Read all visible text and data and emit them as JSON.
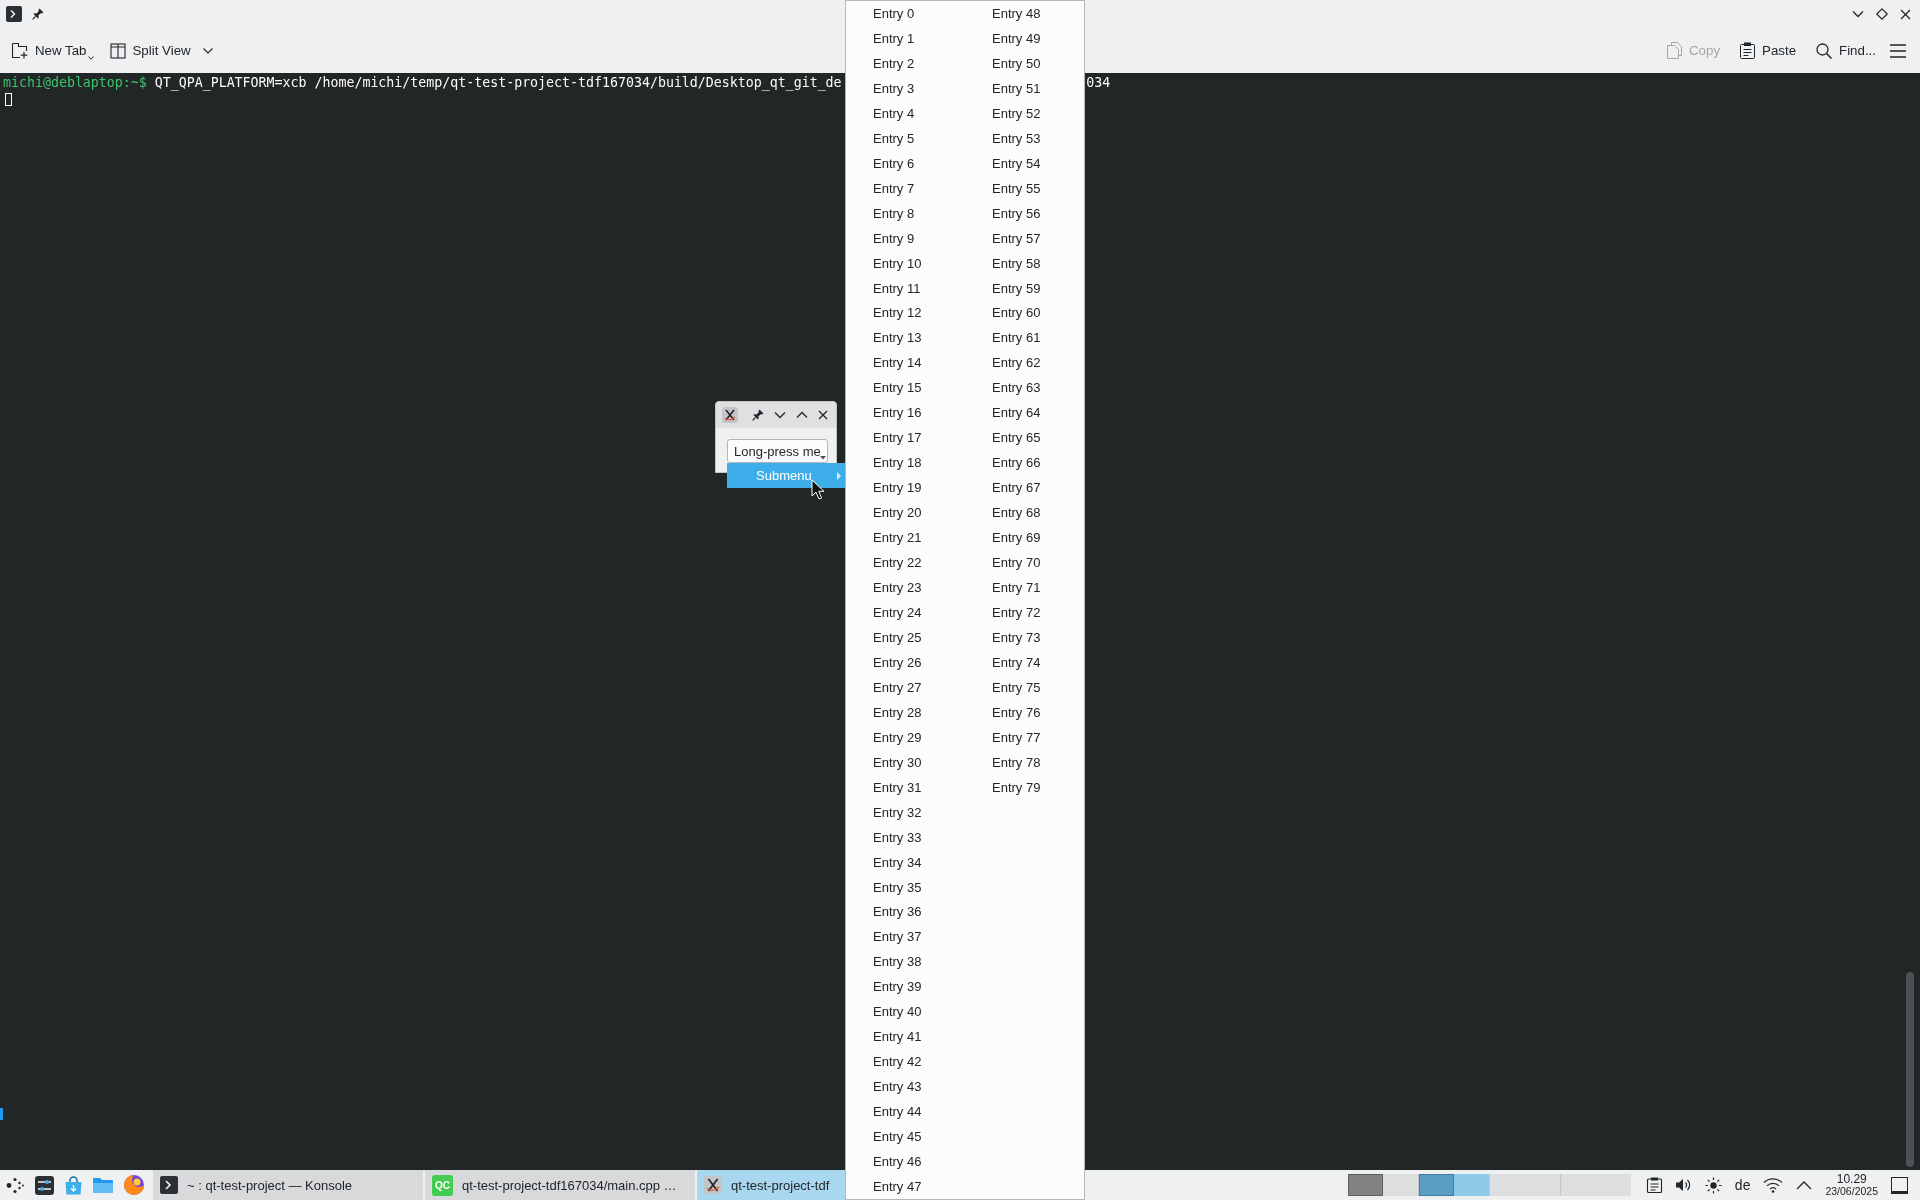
{
  "terminal_window": {
    "toolbar": {
      "left_actions": [
        {
          "label": "New Tab",
          "kind": "new-tab"
        },
        {
          "label": "Split View",
          "kind": "split-view"
        }
      ],
      "right_actions": [
        {
          "label": "Copy",
          "kind": "copy",
          "disabled": true
        },
        {
          "label": "Paste",
          "kind": "paste",
          "disabled": false
        },
        {
          "label": "Find...",
          "kind": "find",
          "disabled": false
        }
      ]
    },
    "terminal": {
      "prompt": "michi@deblaptop:~$",
      "command": "QT_QPA_PLATFORM=xcb /home/michi/temp/qt-test-project-tdf167034/build/Desktop_qt_git_de",
      "command_tail": "034"
    }
  },
  "test_window": {
    "button": "Long-press me"
  },
  "context_menu": {
    "items": [
      {
        "label": "Submenu",
        "selected": true,
        "has_submenu": true
      }
    ]
  },
  "submenu": {
    "entries": [
      {
        "label": "Entry 0",
        "selected": false
      },
      {
        "label": "Entry 1",
        "selected": false
      },
      {
        "label": "Entry 2",
        "selected": false
      },
      {
        "label": "Entry 3",
        "selected": false
      },
      {
        "label": "Entry 4",
        "selected": false
      },
      {
        "label": "Entry 5",
        "selected": false
      },
      {
        "label": "Entry 6",
        "selected": false
      },
      {
        "label": "Entry 7",
        "selected": false
      },
      {
        "label": "Entry 8",
        "selected": false
      },
      {
        "label": "Entry 9",
        "selected": false
      },
      {
        "label": "Entry 10",
        "selected": false
      },
      {
        "label": "Entry 11",
        "selected": false
      },
      {
        "label": "Entry 12",
        "selected": false
      },
      {
        "label": "Entry 13",
        "selected": false
      },
      {
        "label": "Entry 14",
        "selected": false
      },
      {
        "label": "Entry 15",
        "selected": false
      },
      {
        "label": "Entry 16",
        "selected": false
      },
      {
        "label": "Entry 17",
        "selected": false
      },
      {
        "label": "Entry 18",
        "selected": false
      },
      {
        "label": "Entry 19",
        "selected": false
      },
      {
        "label": "Entry 20",
        "selected": false
      },
      {
        "label": "Entry 21",
        "selected": false
      },
      {
        "label": "Entry 22",
        "selected": false
      },
      {
        "label": "Entry 23",
        "selected": false
      },
      {
        "label": "Entry 24",
        "selected": false
      },
      {
        "label": "Entry 25",
        "selected": false
      },
      {
        "label": "Entry 26",
        "selected": false
      },
      {
        "label": "Entry 27",
        "selected": false
      },
      {
        "label": "Entry 28",
        "selected": false
      },
      {
        "label": "Entry 29",
        "selected": false
      },
      {
        "label": "Entry 30",
        "selected": false
      },
      {
        "label": "Entry 31",
        "selected": false
      },
      {
        "label": "Entry 32",
        "selected": false
      },
      {
        "label": "Entry 33",
        "selected": false
      },
      {
        "label": "Entry 34",
        "selected": false
      },
      {
        "label": "Entry 35",
        "selected": false
      },
      {
        "label": "Entry 36",
        "selected": false
      },
      {
        "label": "Entry 37",
        "selected": false
      },
      {
        "label": "Entry 38",
        "selected": false
      },
      {
        "label": "Entry 39",
        "selected": false
      },
      {
        "label": "Entry 40",
        "selected": false
      },
      {
        "label": "Entry 41",
        "selected": false
      },
      {
        "label": "Entry 42",
        "selected": false
      },
      {
        "label": "Entry 43",
        "selected": false
      },
      {
        "label": "Entry 44",
        "selected": false
      },
      {
        "label": "Entry 45",
        "selected": false
      },
      {
        "label": "Entry 46",
        "selected": false
      },
      {
        "label": "Entry 47",
        "selected": false
      },
      {
        "label": "Entry 48",
        "selected": false
      },
      {
        "label": "Entry 49",
        "selected": false
      },
      {
        "label": "Entry 50",
        "selected": false
      },
      {
        "label": "Entry 51",
        "selected": false
      },
      {
        "label": "Entry 52",
        "selected": false
      },
      {
        "label": "Entry 53",
        "selected": false
      },
      {
        "label": "Entry 54",
        "selected": false
      },
      {
        "label": "Entry 55",
        "selected": false
      },
      {
        "label": "Entry 56",
        "selected": false
      },
      {
        "label": "Entry 57",
        "selected": false
      },
      {
        "label": "Entry 58",
        "selected": false
      },
      {
        "label": "Entry 59",
        "selected": false
      },
      {
        "label": "Entry 60",
        "selected": false
      },
      {
        "label": "Entry 61",
        "selected": false
      },
      {
        "label": "Entry 62",
        "selected": false
      },
      {
        "label": "Entry 63",
        "selected": false
      },
      {
        "label": "Entry 64",
        "selected": false
      },
      {
        "label": "Entry 65",
        "selected": false
      },
      {
        "label": "Entry 66",
        "selected": false
      },
      {
        "label": "Entry 67",
        "selected": false
      },
      {
        "label": "Entry 68",
        "selected": false
      },
      {
        "label": "Entry 69",
        "selected": false
      },
      {
        "label": "Entry 70",
        "selected": false
      },
      {
        "label": "Entry 71",
        "selected": false
      },
      {
        "label": "Entry 72",
        "selected": false
      },
      {
        "label": "Entry 73",
        "selected": false
      },
      {
        "label": "Entry 74",
        "selected": false
      },
      {
        "label": "Entry 75",
        "selected": false
      },
      {
        "label": "Entry 76",
        "selected": false
      },
      {
        "label": "Entry 77",
        "selected": false
      },
      {
        "label": "Entry 78",
        "selected": false
      },
      {
        "label": "Entry 79",
        "selected": false
      }
    ]
  },
  "taskbar": {
    "tasks": [
      {
        "label": "~ : qt-test-project — Konsole",
        "kind": "terminal",
        "selected": false
      },
      {
        "label": "qt-test-project-tdf167034/main.cpp …",
        "kind": "creator",
        "icon_label": "QC",
        "selected": false
      },
      {
        "label": "qt-test-project-tdf",
        "kind": "xapp",
        "selected": true
      }
    ],
    "pager": {
      "desktops": [
        {
          "selected": false,
          "has_window": true
        },
        {
          "selected": true,
          "has_window": true
        },
        {
          "selected": false,
          "has_window": false
        },
        {
          "selected": false,
          "has_window": false
        }
      ]
    },
    "tray": {
      "keyboard_layout": "de",
      "time": "10.29",
      "date": "23/06/2025"
    }
  }
}
